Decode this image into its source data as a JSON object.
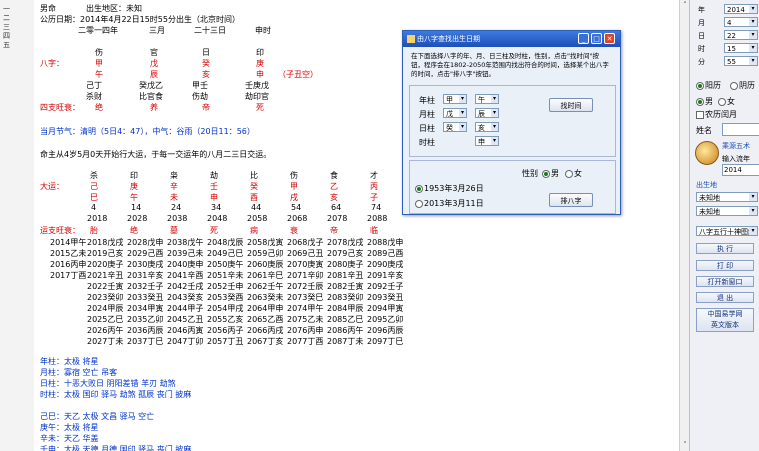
{
  "left_strip": {
    "items": [
      "一",
      "二",
      "三",
      "四",
      "五"
    ]
  },
  "header": {
    "line1_gender": "男命",
    "line1_birthplace": "出生地区：未知",
    "line2": "公历日期：2014年4月22日15时55分出生（北京时间）",
    "line3": [
      "二零一四年",
      "三月",
      "二十三日",
      "申时"
    ]
  },
  "bazi": {
    "shishen": [
      "伤",
      "官",
      "日",
      "印"
    ],
    "row_label": "八字：",
    "gan": [
      "甲",
      "戊",
      "癸",
      "庚"
    ],
    "zhi": [
      "午",
      "辰",
      "亥",
      "申"
    ],
    "kongwang": "（子丑空）",
    "canggan": [
      "己丁",
      "癸戊乙",
      "甲壬",
      "壬庚戊"
    ],
    "cangshen": [
      "杀财",
      "比官食",
      "伤劫",
      "劫印官"
    ],
    "wangshuai_label": "四支旺衰：",
    "wangshuai": [
      "绝",
      "养",
      "帝",
      "死"
    ]
  },
  "jieqi": "当月节气：清明（5日4：47），中气：谷雨（20日11：56）",
  "qiyun": "命主从4岁5月0天开始行大运，于每一交运年的八月二三日交运。",
  "dayun": {
    "shishen": [
      "杀",
      "印",
      "枭",
      "劫",
      "比",
      "伤",
      "食",
      "才"
    ],
    "label": "大运：",
    "gan": [
      "己",
      "庚",
      "辛",
      "壬",
      "癸",
      "甲",
      "乙",
      "丙"
    ],
    "zhi": [
      "巳",
      "午",
      "未",
      "申",
      "酉",
      "戌",
      "亥",
      "子"
    ],
    "ages": [
      "4",
      "14",
      "24",
      "34",
      "44",
      "54",
      "64",
      "74"
    ],
    "years": [
      "2018",
      "2028",
      "2038",
      "2048",
      "2058",
      "2068",
      "2078",
      "2088"
    ],
    "ws_label": "运支旺衰：",
    "ws": [
      "胎",
      "绝",
      "墓",
      "死",
      "病",
      "衰",
      "帝",
      "临"
    ]
  },
  "liunian": {
    "col0": [
      "2014甲午",
      "2015乙未",
      "2016丙申",
      "2017丁酉"
    ],
    "rows": [
      [
        "2018戊戌",
        "2028戊申",
        "2038戊午",
        "2048戊辰",
        "2058戊寅",
        "2068戊子",
        "2078戊戌",
        "2088戊申"
      ],
      [
        "2019己亥",
        "2029己酉",
        "2039己未",
        "2049己巳",
        "2059己卯",
        "2069己丑",
        "2079己亥",
        "2089己酉"
      ],
      [
        "2020庚子",
        "2030庚戌",
        "2040庚申",
        "2050庚午",
        "2060庚辰",
        "2070庚寅",
        "2080庚子",
        "2090庚戌"
      ],
      [
        "2021辛丑",
        "2031辛亥",
        "2041辛酉",
        "2051辛未",
        "2061辛巳",
        "2071辛卯",
        "2081辛丑",
        "2091辛亥"
      ],
      [
        "2022壬寅",
        "2032壬子",
        "2042壬戌",
        "2052壬申",
        "2062壬午",
        "2072壬辰",
        "2082壬寅",
        "2092壬子"
      ],
      [
        "2023癸卯",
        "2033癸丑",
        "2043癸亥",
        "2053癸酉",
        "2063癸未",
        "2073癸巳",
        "2083癸卯",
        "2093癸丑"
      ],
      [
        "2024甲辰",
        "2034甲寅",
        "2044甲子",
        "2054甲戌",
        "2064甲申",
        "2074甲午",
        "2084甲辰",
        "2094甲寅"
      ],
      [
        "2025乙巳",
        "2035乙卯",
        "2045乙丑",
        "2055乙亥",
        "2065乙酉",
        "2075乙未",
        "2085乙巳",
        "2095乙卯"
      ],
      [
        "2026丙午",
        "2036丙辰",
        "2046丙寅",
        "2056丙子",
        "2066丙戌",
        "2076丙申",
        "2086丙午",
        "2096丙辰"
      ],
      [
        "2027丁未",
        "2037丁巳",
        "2047丁卯",
        "2057丁丑",
        "2067丁亥",
        "2077丁酉",
        "2087丁未",
        "2097丁巳"
      ]
    ]
  },
  "shensha": [
    "年柱：太极  将星",
    "月柱：寡宿  空亡  吊客",
    "日柱：十恶大败日  阴阳差错  羊刃  劫煞",
    "时柱：太极  国印  驿马  劫煞  孤辰  丧门  披麻",
    "",
    "己巳：天乙  太极  文昌  驿马  空亡",
    "庚午：太极  将星",
    "辛未：天乙  华盖",
    "壬申：太极  天德  月德  国印  驿马  丧门  披麻"
  ],
  "dialog": {
    "title": "由八字查找出生日期",
    "desc": "在下面选择八字的年、月、日三柱及时柱，性别，点击\"找时间\"按钮，程序会在1802-2050年范围内找出符合的时间，选择某个出八字的时间，点击\"排八字\"按钮。",
    "labels": [
      "年柱",
      "月柱",
      "日柱",
      "时柱"
    ],
    "gan_vals": [
      "甲",
      "戊",
      "癸",
      ""
    ],
    "zhi_vals": [
      "午",
      "辰",
      "亥",
      "申"
    ],
    "find_button": "找时间",
    "gender_label": "性别",
    "gender_male": "男",
    "gender_female": "女",
    "result1": "1953年3月26日",
    "result2": "2013年3月11日",
    "paipan_button": "排八字"
  },
  "right_panel": {
    "fields": [
      {
        "label": "年",
        "value": "2014"
      },
      {
        "label": "月",
        "value": "4"
      },
      {
        "label": "日",
        "value": "22"
      },
      {
        "label": "时",
        "value": "15"
      },
      {
        "label": "分",
        "value": "55"
      }
    ],
    "cal_solar": "阳历",
    "cal_lunar": "阴历",
    "gender_male": "男",
    "gender_female": "女",
    "leap_month": "农历闰月",
    "name_label": "姓名",
    "taiji_text": "乘源五术",
    "birth_label1": "输入流年",
    "year_value": "2014",
    "birthplace_label": "出生地",
    "province": "未知地",
    "city": "未知地",
    "mode": "八字五行十神图解",
    "btn_execute": "执 行",
    "btn_print": "打 印",
    "btn_open": "打开新窗口",
    "btn_exit": "退 出",
    "btn_link": "中国易学网\n英文版本"
  },
  "colors": {
    "red": "#d40000",
    "blue": "#0033cc",
    "title_blue": "#1c4fb8"
  }
}
